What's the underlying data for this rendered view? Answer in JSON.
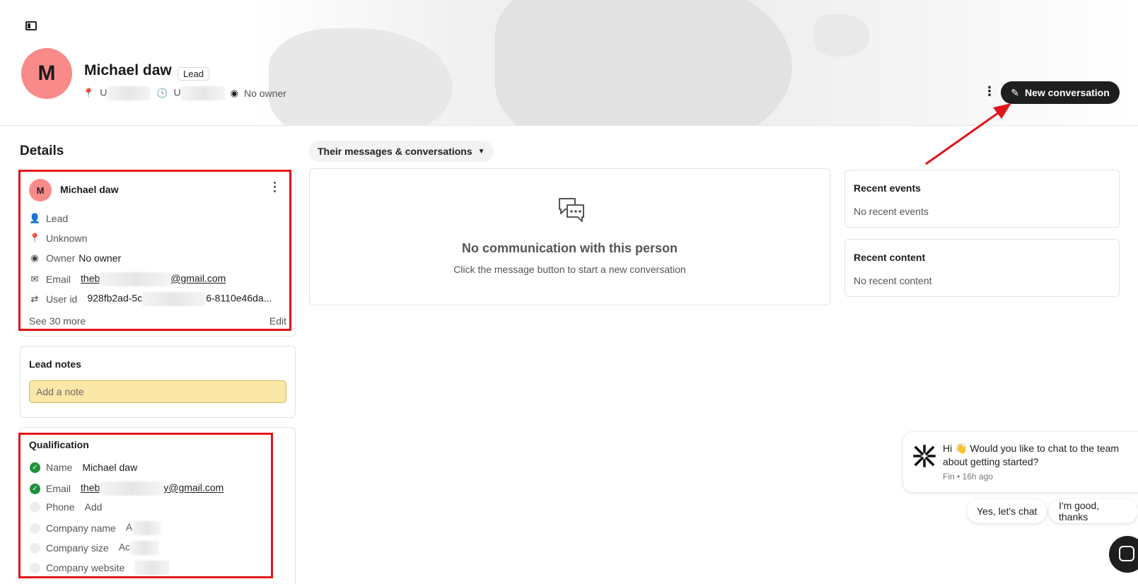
{
  "header": {
    "avatar_initial": "M",
    "name": "Michael daw",
    "badge": "Lead",
    "location_prefix": "U",
    "time_prefix": "U",
    "owner": "No owner",
    "new_conversation_label": "New conversation"
  },
  "details": {
    "title": "Details",
    "contact": {
      "avatar_initial": "M",
      "name": "Michael daw",
      "type": "Lead",
      "location": "Unknown",
      "owner_label": "Owner",
      "owner_value": "No owner",
      "email_label": "Email",
      "email_prefix": "theb",
      "email_suffix": "@gmail.com",
      "userid_label": "User id",
      "userid_prefix": "928fb2ad-5c",
      "userid_suffix": "6-8110e46da...",
      "see_more": "See 30 more",
      "edit": "Edit"
    },
    "notes": {
      "title": "Lead notes",
      "placeholder": "Add a note"
    },
    "qualification": {
      "title": "Qualification",
      "rows": [
        {
          "label": "Name",
          "value": "Michael daw",
          "done": true
        },
        {
          "label": "Email",
          "value_prefix": "theb",
          "value_suffix": "y@gmail.com",
          "done": true
        },
        {
          "label": "Phone",
          "value": "Add",
          "done": false
        },
        {
          "label": "Company name",
          "value": "A",
          "done": false
        },
        {
          "label": "Company size",
          "value": "Ac",
          "done": false
        },
        {
          "label": "Company website",
          "value": "",
          "done": false
        }
      ]
    }
  },
  "messages": {
    "dropdown_label": "Their messages & conversations",
    "empty_title": "No communication with this person",
    "empty_subtitle": "Click the message button to start a new conversation"
  },
  "sidebar": {
    "events_title": "Recent events",
    "events_empty": "No recent events",
    "content_title": "Recent content",
    "content_empty": "No recent content"
  },
  "fin": {
    "message": "Hi 👋 Would you like to chat to the team about getting started?",
    "meta": "Fin • 16h ago",
    "yes_label": "Yes, let's chat",
    "no_label": "I'm good, thanks"
  },
  "colors": {
    "avatar": "#f88b89",
    "accent_dark": "#1e1e1e",
    "annotation_red": "#e3141b",
    "check_green": "#1f8f3a",
    "note_bg": "#fbe7a6"
  }
}
